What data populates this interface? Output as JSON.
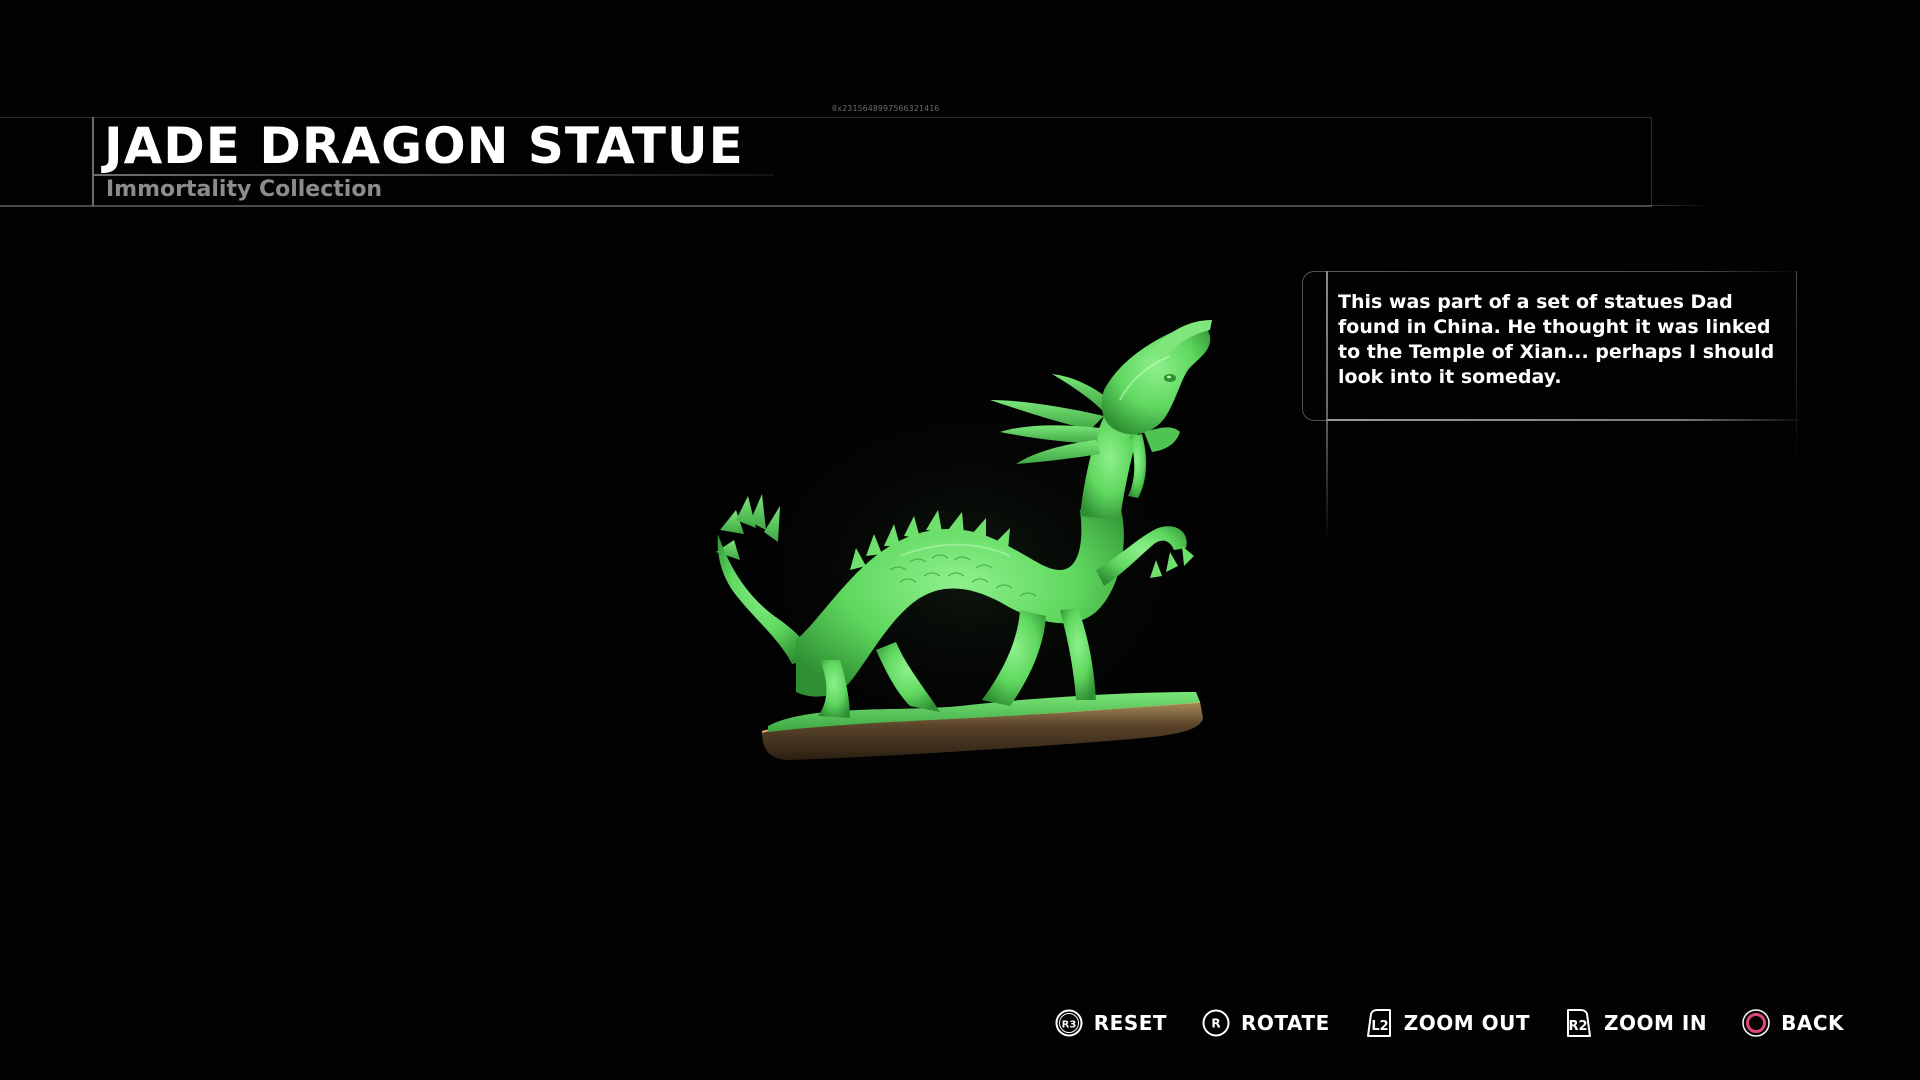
{
  "header": {
    "item_id": "0x2315648997566321416",
    "title": "JADE DRAGON STATUE",
    "subtitle": "Immortality Collection"
  },
  "description": {
    "text": "This was part of a set of statues Dad found in China. He thought it was linked to the Temple of Xian... perhaps I should look into it someday."
  },
  "model": {
    "icon": "jade-dragon-statue",
    "jade_color": "#5fd85f",
    "base_color": "#4a3a28"
  },
  "controls": [
    {
      "button": "R3",
      "label": "RESET",
      "icon": "r3-button-icon"
    },
    {
      "button": "R",
      "label": "ROTATE",
      "icon": "right-stick-icon"
    },
    {
      "button": "L2",
      "label": "ZOOM OUT",
      "icon": "l2-trigger-icon"
    },
    {
      "button": "R2",
      "label": "ZOOM IN",
      "icon": "r2-trigger-icon"
    },
    {
      "button": "",
      "label": "BACK",
      "icon": "circle-button-icon",
      "color": "#e0457b"
    }
  ]
}
